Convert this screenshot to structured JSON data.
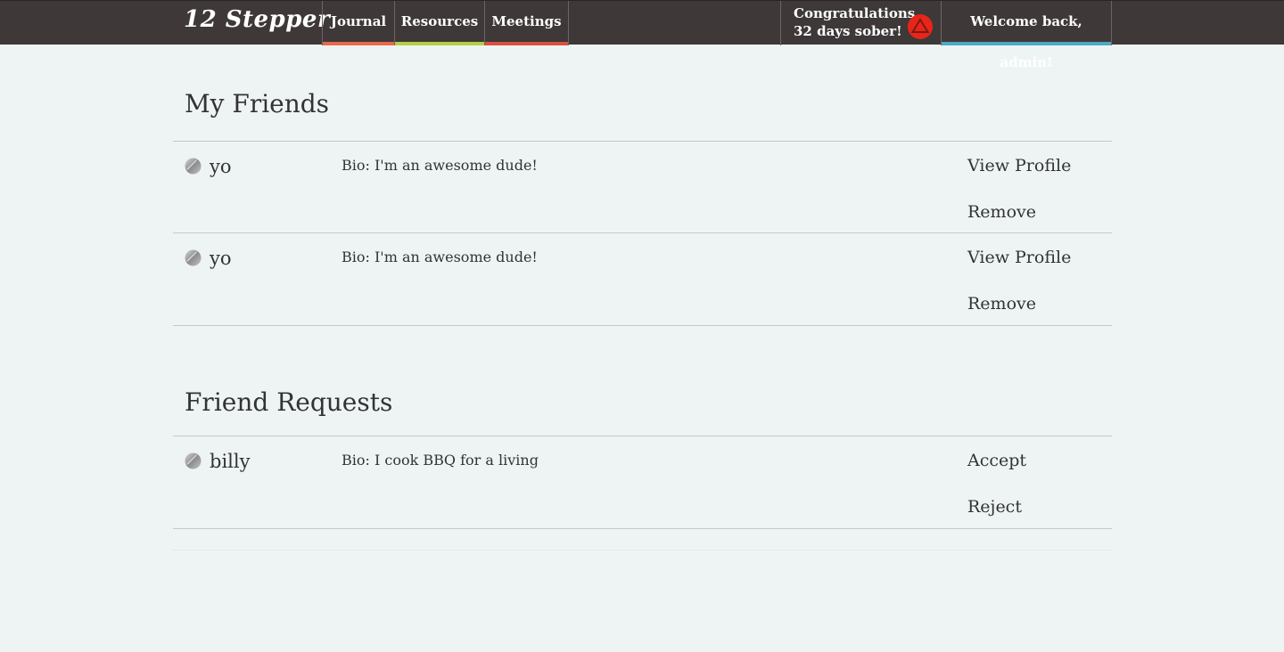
{
  "nav": {
    "brand": "12 Stepper",
    "items": [
      {
        "label": "Journal",
        "accent": "#e8694a"
      },
      {
        "label": "Resources",
        "accent": "#b4cf45"
      },
      {
        "label": "Meetings",
        "accent": "#d9503f"
      }
    ],
    "congrats_line1": "Congratulations,",
    "congrats_line2": "32 days sober!",
    "badge_color": "#e8251a",
    "welcome": "Welcome back, admin!",
    "welcome_accent": "#4da9c4"
  },
  "friends": {
    "title": "My Friends",
    "items": [
      {
        "name": "yo",
        "bio": "Bio: I'm an awesome dude!",
        "action1": "View Profile",
        "action2": "Remove"
      },
      {
        "name": "yo",
        "bio": "Bio: I'm an awesome dude!",
        "action1": "View Profile",
        "action2": "Remove"
      }
    ]
  },
  "requests": {
    "title": "Friend Requests",
    "items": [
      {
        "name": "billy",
        "bio": "Bio: I cook BBQ for a living",
        "action1": "Accept",
        "action2": "Reject"
      }
    ]
  },
  "colors": {
    "navbar": "#3e3838",
    "background": "#eef4f4"
  }
}
